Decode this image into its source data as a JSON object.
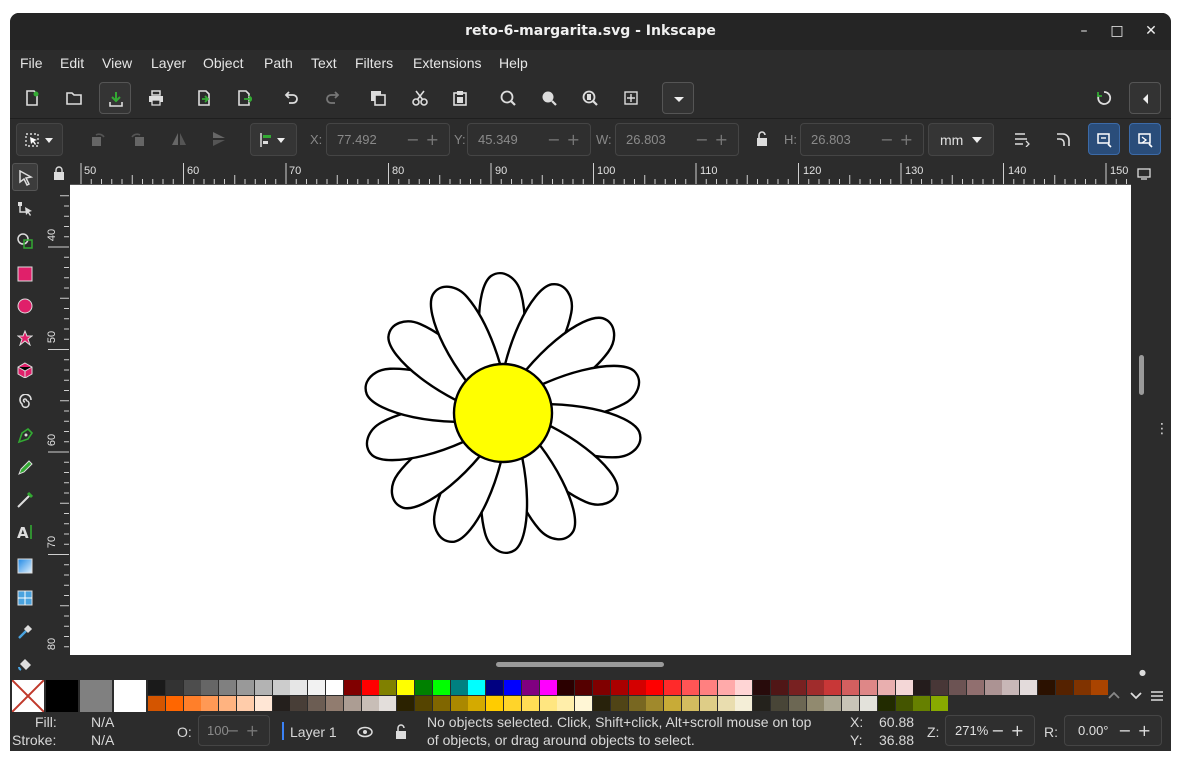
{
  "window": {
    "title": "reto-6-margarita.svg - Inkscape",
    "minimize": "–",
    "maximize": "□",
    "close": "✕"
  },
  "menu": [
    "File",
    "Edit",
    "View",
    "Layer",
    "Object",
    "Path",
    "Text",
    "Filters",
    "Extensions",
    "Help"
  ],
  "toolctl": {
    "x_label": "X:",
    "x_value": "77.492",
    "y_label": "Y:",
    "y_value": "45.349",
    "w_label": "W:",
    "w_value": "26.803",
    "h_label": "H:",
    "h_value": "26.803",
    "unit": "mm"
  },
  "rulers": {
    "top": [
      "50",
      "60",
      "70",
      "80",
      "90",
      "100",
      "110",
      "120",
      "130",
      "140",
      "150"
    ],
    "left": [
      "40",
      "50",
      "60",
      "70",
      "80"
    ]
  },
  "drawing": {
    "petal_fill": "#ffffff",
    "center_fill": "#ffff00",
    "stroke": "#000000"
  },
  "status": {
    "fill_label": "Fill:",
    "fill_value": "N/A",
    "stroke_label": "Stroke:",
    "stroke_value": "N/A",
    "opacity_label": "O:",
    "opacity_value": "100",
    "layer": "Layer 1",
    "message_line1": "No objects selected. Click, Shift+click, Alt+scroll mouse on top",
    "message_line2": "of objects, or drag around objects to select.",
    "x_label": "X:",
    "x_value": "60.88",
    "y_label": "Y:",
    "y_value": "36.88",
    "zoom_label": "Z:",
    "zoom_value": "271%",
    "rotate_label": "R:",
    "rotate_value": "0.00°"
  },
  "palette": {
    "top": [
      "#1a1a1a",
      "#333333",
      "#4d4d4d",
      "#666666",
      "#808080",
      "#999999",
      "#b3b3b3",
      "#cccccc",
      "#e6e6e6",
      "#f2f2f2",
      "#ffffff",
      "#800000",
      "#ff0000",
      "#808000",
      "#ffff00",
      "#008000",
      "#00ff00",
      "#008080",
      "#00ffff",
      "#000080",
      "#0000ff",
      "#800080",
      "#ff00ff",
      "#2b0000",
      "#550000",
      "#800000",
      "#aa0000",
      "#d40000",
      "#ff0000",
      "#ff2a2a",
      "#ff5555",
      "#ff8080",
      "#ffaaaa",
      "#ffd5d5",
      "#280b0b",
      "#501616",
      "#782121",
      "#a02c2c",
      "#c83737",
      "#d35f5f",
      "#de8787",
      "#e9afaf",
      "#f4d7d7",
      "#241c1c",
      "#483737",
      "#6c5353",
      "#916f6f",
      "#ac9393",
      "#c8b7b7",
      "#e3dbdb",
      "#2b1100",
      "#552200",
      "#803300",
      "#aa4400"
    ],
    "bottom": [
      "#d45500",
      "#ff6600",
      "#ff7f2a",
      "#ff9955",
      "#ffb380",
      "#ffccaa",
      "#ffe6d5",
      "#241f1c",
      "#483e37",
      "#6c5d53",
      "#917c6f",
      "#ac9d93",
      "#c8beb7",
      "#e3dedb",
      "#2b2200",
      "#554400",
      "#806600",
      "#aa8800",
      "#d4aa00",
      "#ffcc00",
      "#ffd42a",
      "#ffdd55",
      "#ffe680",
      "#ffeeaa",
      "#fff6d5",
      "#28220b",
      "#504416",
      "#786721",
      "#a0892c",
      "#c8ab37",
      "#d3bc5f",
      "#decd87",
      "#e9ddaf",
      "#f4eed7",
      "#24221c",
      "#484537",
      "#6c6753",
      "#918a6f",
      "#aca793",
      "#c8c4b7",
      "#e3e2db",
      "#222b00",
      "#445500",
      "#668000",
      "#88aa00"
    ]
  }
}
